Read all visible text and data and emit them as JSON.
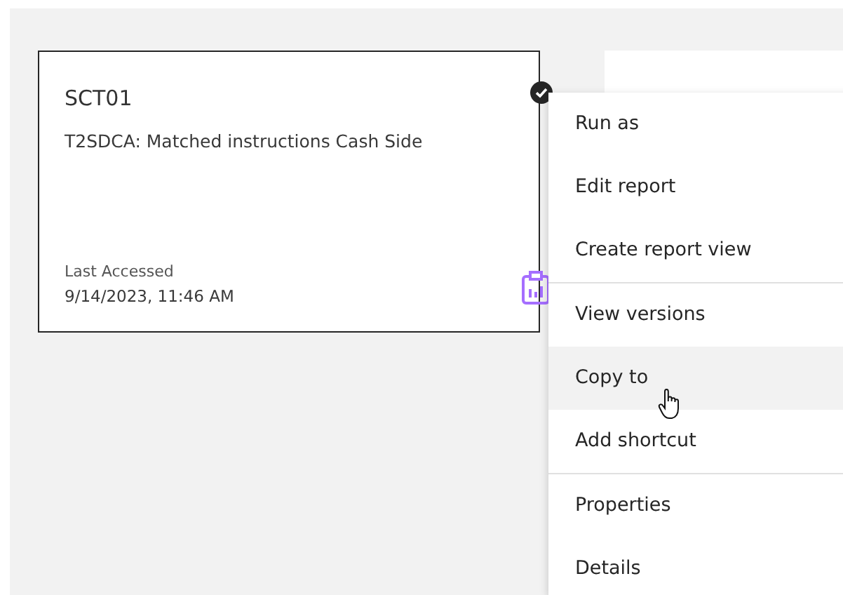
{
  "cards": [
    {
      "title": "SCT01",
      "description": "T2SDCA: Matched instructions Cash Side",
      "meta_label": "Last Accessed",
      "meta_value": "9/14/2023, 11:46 AM",
      "selected": true
    }
  ],
  "context_menu": {
    "groups": [
      {
        "items": [
          {
            "label": "Run as",
            "highlighted": false
          },
          {
            "label": "Edit report",
            "highlighted": false
          },
          {
            "label": "Create report view",
            "highlighted": false
          }
        ]
      },
      {
        "items": [
          {
            "label": "View versions",
            "highlighted": false
          },
          {
            "label": "Copy to",
            "highlighted": true
          },
          {
            "label": "Add shortcut",
            "highlighted": false
          }
        ]
      },
      {
        "items": [
          {
            "label": "Properties",
            "highlighted": false
          },
          {
            "label": "Details",
            "highlighted": false
          }
        ]
      }
    ]
  }
}
